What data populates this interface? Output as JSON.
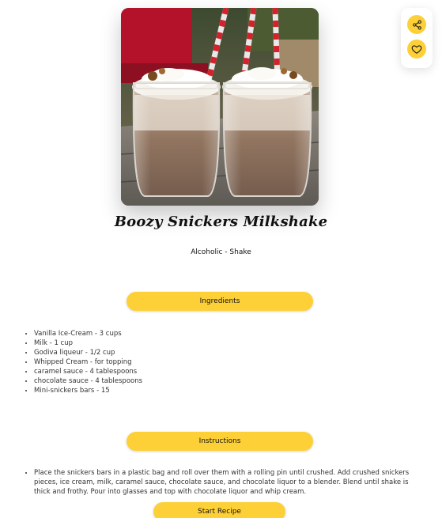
{
  "recipe": {
    "title": "Boozy Snickers Milkshake",
    "category_line": "Alcoholic - Shake",
    "image_alt": "Boozy Snickers Milkshake photo"
  },
  "actions": {
    "share_icon": "share-icon",
    "favorite_icon": "heart-icon"
  },
  "sections": {
    "ingredients_label": "Ingredients",
    "instructions_label": "Instructions",
    "start_label": "Start Recipe"
  },
  "ingredients": [
    "Vanilla Ice-Cream - 3 cups",
    "Milk - 1 cup",
    "Godiva liqueur - 1/2 cup",
    "Whipped Cream - for topping",
    "caramel sauce - 4 tablespoons",
    "chocolate sauce - 4 tablespoons",
    "Mini-snickers bars - 15"
  ],
  "instructions": [
    "Place the snickers bars in a plastic bag and roll over them with a rolling pin until crushed. Add crushed snickers pieces, ice cream, milk, caramel sauce, chocolate sauce, and chocolate liquor to a blender. Blend until shake is thick and frothy. Pour into glasses and top with chocolate liquor and whip cream."
  ],
  "colors": {
    "accent": "#fdd037",
    "text": "#111111"
  }
}
